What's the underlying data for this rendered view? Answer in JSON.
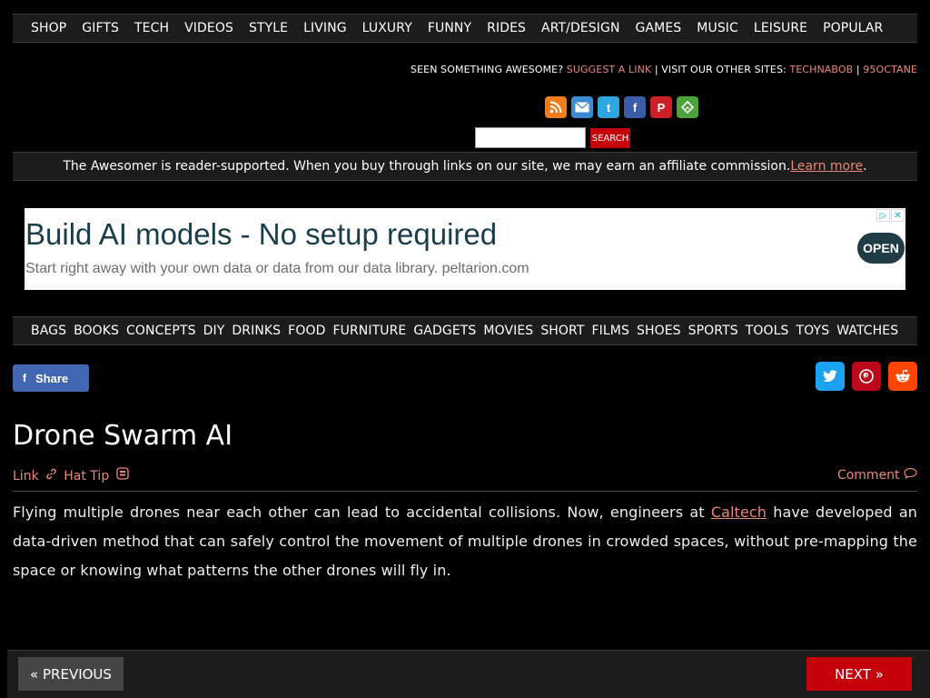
{
  "top_nav": [
    "SHOP",
    "GIFTS",
    "TECH",
    "VIDEOS",
    "STYLE",
    "LIVING",
    "LUXURY",
    "FUNNY",
    "RIDES",
    "ART/DESIGN",
    "GAMES",
    "MUSIC",
    "LEISURE",
    "POPULAR"
  ],
  "suggest": {
    "prefix": "SEEN SOMETHING AWESOME? ",
    "suggest_link": "SUGGEST A LINK",
    "middle": " | VISIT OUR OTHER SITES: ",
    "site1": "TECHNABOB",
    "sep": " | ",
    "site2": "95OCTANE"
  },
  "social_icons": {
    "rss": "rss-icon",
    "email": "email-icon",
    "twitter": "twitter-icon",
    "facebook": "facebook-icon",
    "pinterest": "pinterest-icon",
    "feedly": "feedly-icon"
  },
  "search": {
    "value": "",
    "button_label": "SEARCH"
  },
  "affiliate": {
    "text": "The Awesomer is reader-supported. When you buy through links on our site, we may earn an affiliate commission.",
    "link": "Learn more",
    "period": "."
  },
  "ad": {
    "title": "Build AI models - No setup required",
    "subtitle": "Start right away with your own data or data from our data library. peltarion.com",
    "open_label": "OPEN",
    "choices_glyph": "▷",
    "close_glyph": "✕"
  },
  "category_nav": [
    "BAGS",
    "BOOKS",
    "CONCEPTS",
    "DIY",
    "DRINKS",
    "FOOD",
    "FURNITURE",
    "GADGETS",
    "MOVIES",
    "SHORT",
    "FILMS",
    "SHOES",
    "SPORTS",
    "TOOLS",
    "TOYS",
    "WATCHES"
  ],
  "share": {
    "label": "Share",
    "icon_glyph": "f"
  },
  "post": {
    "title": "Drone Swarm AI",
    "link_label": "Link",
    "hat_tip_label": "Hat Tip",
    "comment_label": "Comment",
    "body_before": "Flying multiple drones near each other can lead to accidental collisions. Now, engineers at ",
    "body_link": "Caltech",
    "body_after": " have developed an data-driven method that can safely control the movement of multiple drones in crowded spaces, without pre-mapping the space or knowing what patterns the other drones will fly in."
  },
  "pagination": {
    "previous": "« PREVIOUS",
    "next": "NEXT »"
  },
  "colors": {
    "accent_link": "#e9877a",
    "red_button": "#c4000b",
    "bar_bg": "#1c1c1c"
  }
}
